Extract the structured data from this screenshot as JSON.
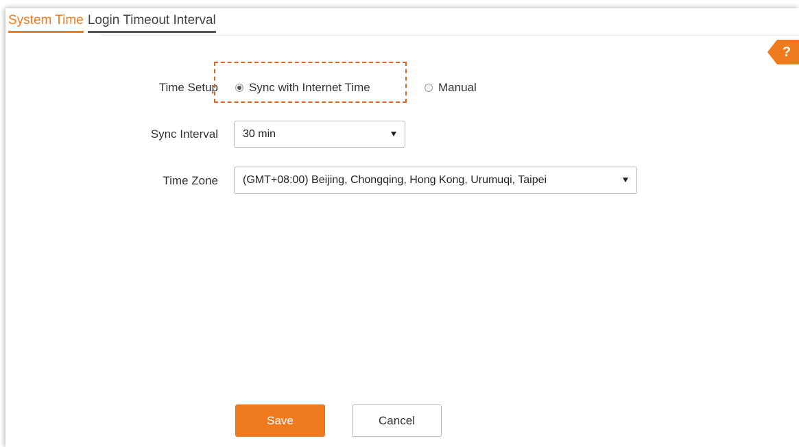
{
  "tabs": {
    "system_time": "System Time",
    "login_timeout": "Login Timeout Interval"
  },
  "help": {
    "label": "?"
  },
  "form": {
    "time_setup_label": "Time Setup",
    "time_setup_options": {
      "sync": "Sync with Internet Time",
      "manual": "Manual",
      "selected": "sync"
    },
    "sync_interval_label": "Sync Interval",
    "sync_interval_value": "30 min",
    "time_zone_label": "Time Zone",
    "time_zone_value": "(GMT+08:00) Beijing, Chongqing, Hong Kong, Urumuqi, Taipei"
  },
  "buttons": {
    "save": "Save",
    "cancel": "Cancel"
  },
  "colors": {
    "accent": "#f07a1e",
    "highlight": "#e0651c"
  }
}
